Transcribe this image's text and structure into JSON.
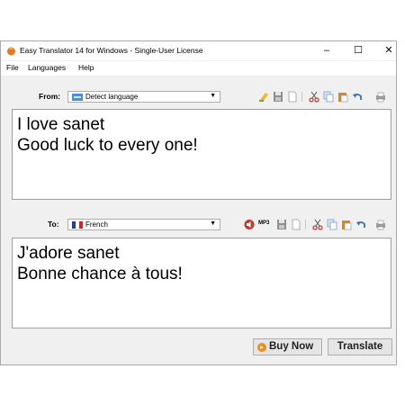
{
  "window": {
    "title": "Easy Translator 14 for Windows - Single-User License",
    "controls": {
      "minimize": "–",
      "maximize": "☐",
      "close": "✕"
    }
  },
  "menu": [
    "File",
    "Languages",
    "Help"
  ],
  "from": {
    "label": "From:",
    "language": "Detect language",
    "text_lines": [
      "I love sanet",
      "Good luck to every one!"
    ]
  },
  "to": {
    "label": "To:",
    "language": "French",
    "mp3_label": "MP3",
    "text_lines": [
      "J'adore sanet",
      "Bonne chance à tous!"
    ]
  },
  "buttons": {
    "buy_now": "Buy Now",
    "translate": "Translate"
  },
  "icons": {
    "from_toolbar": [
      "clear-icon",
      "save-icon",
      "new-document-icon",
      "cut-icon",
      "copy-icon",
      "paste-icon",
      "undo-icon",
      "print-icon"
    ],
    "to_toolbar": [
      "speak-icon",
      "mp3-icon",
      "save-icon",
      "new-document-icon",
      "cut-icon",
      "copy-icon",
      "paste-icon",
      "undo-icon",
      "print-icon"
    ]
  },
  "colors": {
    "buy_now_accent": "#f08a1c",
    "french_flag": [
      "#1f3f9a",
      "#ffffff",
      "#d4202a"
    ]
  }
}
